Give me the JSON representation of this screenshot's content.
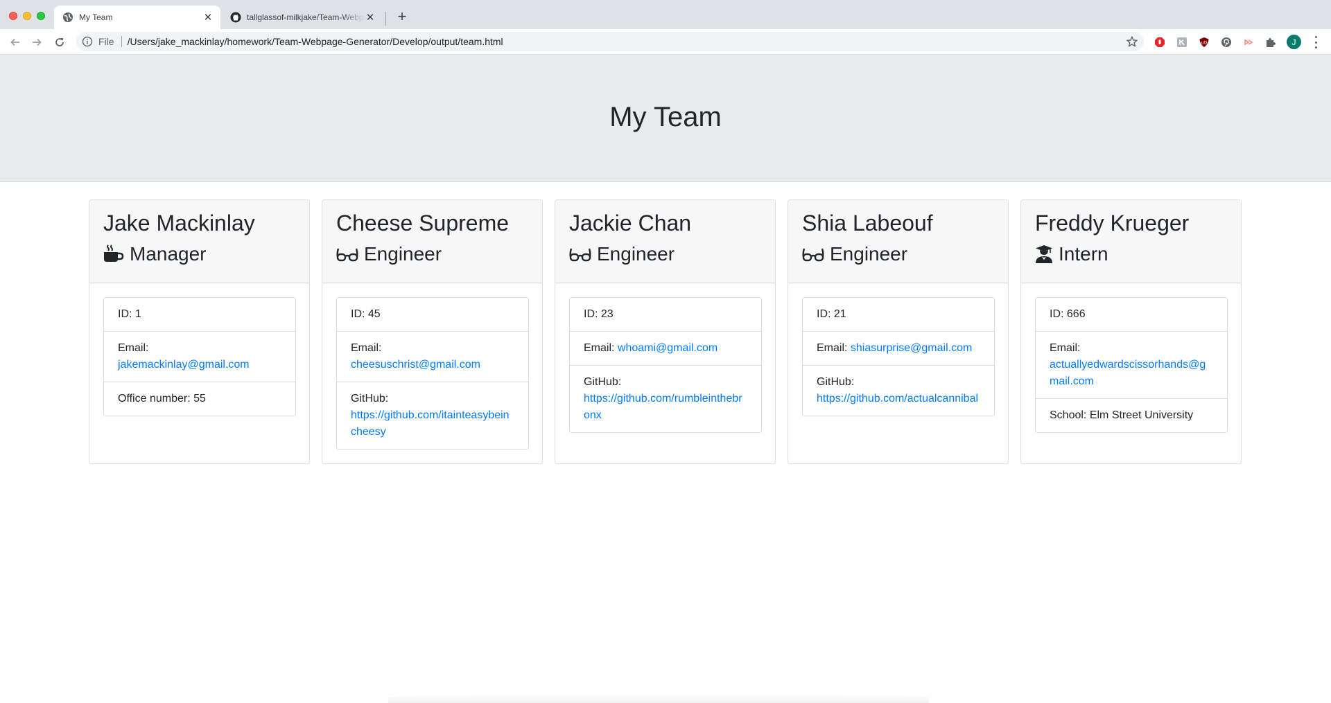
{
  "browser": {
    "tabs": [
      {
        "title": "My Team",
        "favicon": "globe-icon",
        "active": true
      },
      {
        "title": "tallglassof-milkjake/Team-Webpage-Generator",
        "favicon": "github-icon",
        "active": false
      }
    ],
    "address": {
      "scheme_label": "File",
      "url": "/Users/jake_mackinlay/homework/Team-Webpage-Generator/Develop/output/team.html"
    },
    "profile_initial": "J",
    "extensions": [
      "adblock-icon",
      "extension-grey-icon",
      "ublock-icon",
      "pinterest-icon",
      "cast-icon",
      "puzzle-icon"
    ]
  },
  "page": {
    "title": "My Team",
    "colors": {
      "link": "#007bff",
      "jumbotron": "#e9ecef",
      "header": "#f7f7f7"
    },
    "employees": [
      {
        "name": "Jake Mackinlay",
        "role": "Manager",
        "role_icon": "mug-icon",
        "id_text": "ID: 1",
        "email_label": "Email:",
        "email": "jakemackinlay@gmail.com",
        "extra_label": "Office number: 55"
      },
      {
        "name": "Cheese Supreme",
        "role": "Engineer",
        "role_icon": "glasses-icon",
        "id_text": "ID: 45",
        "email_label": "Email:",
        "email": "cheesuschrist@gmail.com",
        "extra_label": "GitHub:",
        "extra_link": "https://github.com/itainteasybeincheesy"
      },
      {
        "name": "Jackie Chan",
        "role": "Engineer",
        "role_icon": "glasses-icon",
        "id_text": "ID: 23",
        "email_label": "Email:",
        "email": "whoami@gmail.com",
        "extra_label": "GitHub:",
        "extra_link": "https://github.com/rumbleinthebronx"
      },
      {
        "name": "Shia Labeouf",
        "role": "Engineer",
        "role_icon": "glasses-icon",
        "id_text": "ID: 21",
        "email_label": "Email:",
        "email": "shiasurprise@gmail.com",
        "extra_label": "GitHub:",
        "extra_link": "https://github.com/actualcannibal"
      },
      {
        "name": "Freddy Krueger",
        "role": "Intern",
        "role_icon": "graduate-icon",
        "id_text": "ID: 666",
        "email_label": "Email:",
        "email": "actuallyedwardscissorhands@gmail.com",
        "extra_label": "School: Elm Street University"
      }
    ]
  }
}
